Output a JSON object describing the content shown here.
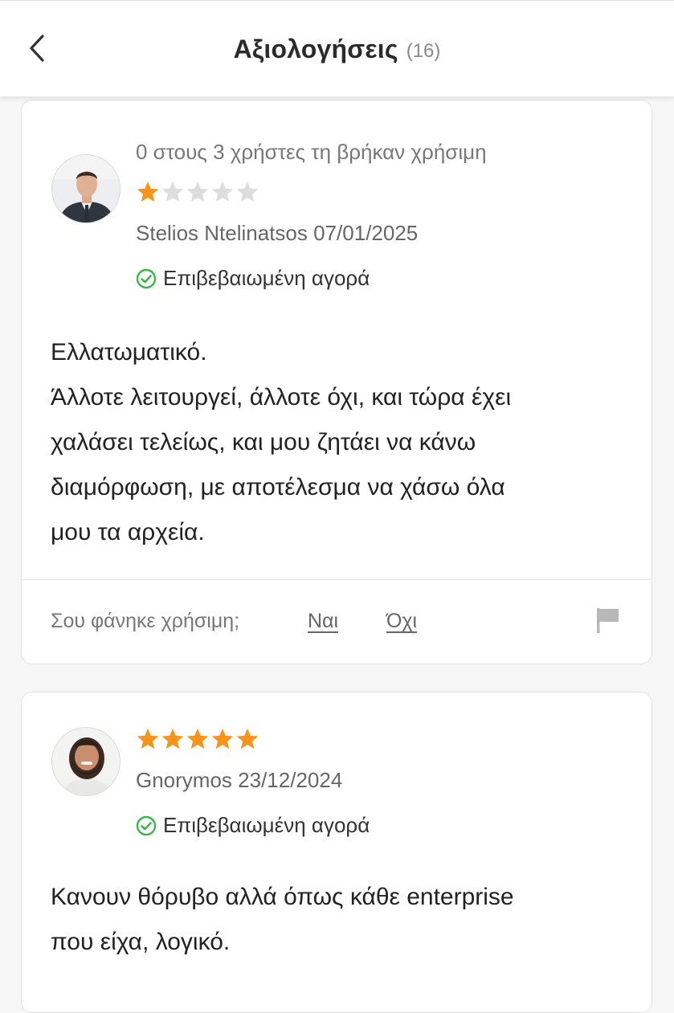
{
  "header": {
    "title": "Αξιολογήσεις",
    "count": "(16)",
    "back_icon": "chevron-left-icon"
  },
  "colors": {
    "star_filled": "#f7941d",
    "star_empty": "#dddddd",
    "verified_green": "#3bb54a"
  },
  "reviews": [
    {
      "helpful_summary": "0 στους 3 χρήστες τη βρήκαν χρήσιμη",
      "rating": 1,
      "rating_max": 5,
      "author": "Stelios Ntelinatsos",
      "date": "07/01/2025",
      "verified_label": "Επιβεβαιωμένη αγορά",
      "text_lines": [
        "Ελλατωματικό.",
        "Άλλοτε λειτουργεί, άλλοτε όχι, και τώρα έχει",
        "χαλάσει τελείως, και μου ζητάει να κάνω",
        "διαμόρφωση, με αποτέλεσμα να χάσω όλα",
        "μου τα αρχεία."
      ],
      "feedback_question": "Σου φάνηκε χρήσιμη;",
      "yes_label": "Ναι",
      "no_label": "Όχι"
    },
    {
      "rating": 5,
      "rating_max": 5,
      "author": "Gnorymos",
      "date": "23/12/2024",
      "verified_label": "Επιβεβαιωμένη αγορά",
      "text_lines": [
        "Κανουν θόρυβο αλλά όπως κάθε enterprise",
        "που είχα, λογικό."
      ]
    }
  ]
}
